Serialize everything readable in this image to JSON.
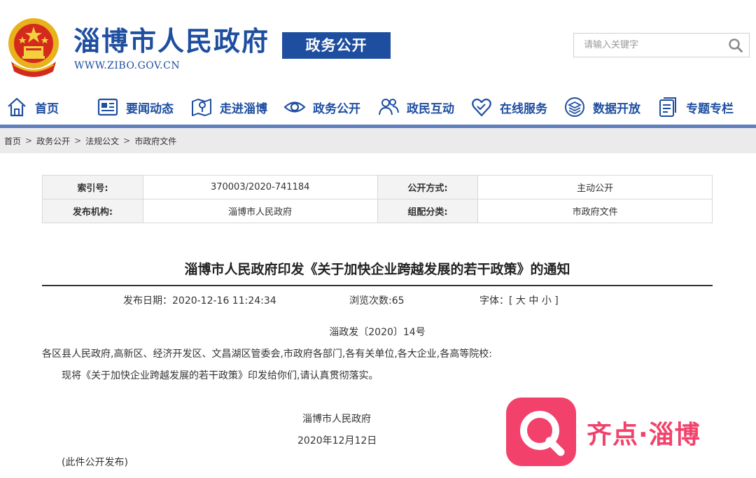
{
  "header": {
    "site_title": "淄博市人民政府",
    "site_url": "WWW.ZIBO.GOV.CN",
    "section_badge": "政务公开",
    "brand_color": "#1e4ea0"
  },
  "search": {
    "placeholder": "请输入关键字",
    "icon": "search-icon"
  },
  "nav": {
    "items": [
      {
        "label": "首页",
        "icon": "home-icon"
      },
      {
        "label": "要闻动态",
        "icon": "news-icon"
      },
      {
        "label": "走进淄博",
        "icon": "map-icon"
      },
      {
        "label": "政务公开",
        "icon": "eye-icon"
      },
      {
        "label": "政民互动",
        "icon": "people-icon"
      },
      {
        "label": "在线服务",
        "icon": "heart-icon"
      },
      {
        "label": "数据开放",
        "icon": "layers-icon"
      },
      {
        "label": "专题专栏",
        "icon": "document-icon"
      }
    ]
  },
  "breadcrumb": {
    "items": [
      "首页",
      "政务公开",
      "法规公文",
      "市政府文件"
    ],
    "separator": ">"
  },
  "info_table": {
    "index_label": "索引号:",
    "index_value": "370003/2020-741184",
    "publish_mode_label": "公开方式:",
    "publish_mode_value": "主动公开",
    "issuer_label": "发布机构:",
    "issuer_value": "淄博市人民政府",
    "category_label": "组配分类:",
    "category_value": "市政府文件"
  },
  "document": {
    "title": "淄博市人民政府印发《关于加快企业跨越发展的若干政策》的通知",
    "publish_date": "发布日期：2020-12-16 11:24:34",
    "views": "浏览次数:65",
    "font_label": "字体：[",
    "font_large": "大",
    "font_medium": "中",
    "font_small": "小",
    "font_close": "]",
    "doc_number": "淄政发〔2020〕14号",
    "recipients": "各区县人民政府,高新区、经济开发区、文昌湖区管委会,市政府各部门,各有关单位,各大企业,各高等院校:",
    "body": "现将《关于加快企业跨越发展的若干政策》印发给你们,请认真贯彻落实。",
    "signer": "淄博市人民政府",
    "sign_date": "2020年12月12日",
    "release_note": "(此件公开发布)"
  },
  "watermark": {
    "text": "齐点·淄博",
    "color": "#f2416a"
  }
}
